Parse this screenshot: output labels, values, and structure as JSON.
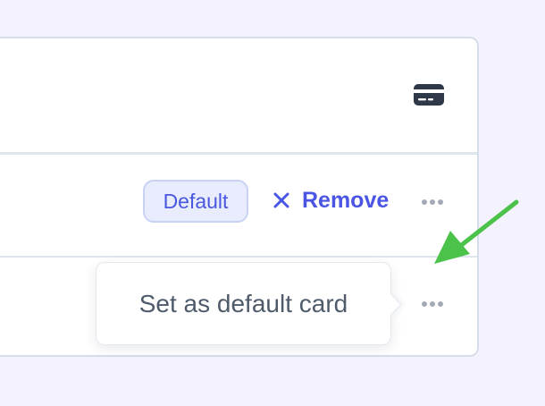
{
  "card_list": {
    "header_icon": "credit-card-icon",
    "default_row": {
      "badge_label": "Default",
      "remove_label": "Remove",
      "remove_icon": "close-icon",
      "more_icon": "more-horizontal-icon"
    },
    "second_row": {
      "more_icon": "more-horizontal-icon"
    }
  },
  "tooltip": {
    "label": "Set as default card"
  },
  "annotation": {
    "arrow_color": "#4bc34a",
    "arrow_icon": "arrow-icon"
  },
  "colors": {
    "accent": "#4b55e3",
    "badge_bg": "#e9ecfd",
    "badge_border": "#c9d2f4",
    "text_muted": "#4f5b6b",
    "icon_dark": "#2e3848",
    "page_bg": "#f4f3fd"
  }
}
